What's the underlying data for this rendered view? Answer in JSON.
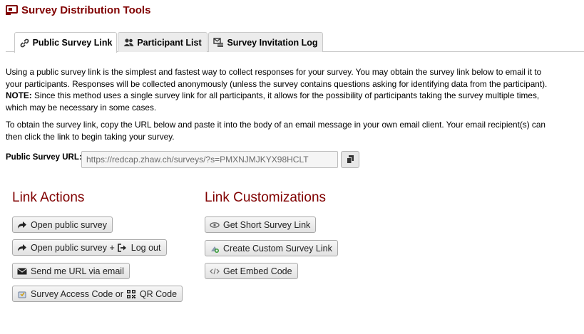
{
  "page": {
    "title": "Survey Distribution Tools",
    "title_icon": "survey-distribution-icon",
    "accent_color": "#800000"
  },
  "tabs": [
    {
      "label": "Public Survey Link",
      "icon": "link-icon",
      "active": true
    },
    {
      "label": "Participant List",
      "icon": "users-icon",
      "active": false
    },
    {
      "label": "Survey Invitation Log",
      "icon": "mail-list-icon",
      "active": false
    }
  ],
  "intro": {
    "text": "Using a public survey link is the simplest and fastest way to collect responses for your survey. You may obtain the survey link below to email it to your participants. Responses will be collected anonymously (unless the survey contains questions asking for identifying data from the participant).",
    "note_label": "NOTE:",
    "note_text": "Since this method uses a single survey link for all participants, it allows for the possibility of participants taking the survey multiple times, which may be necessary in some cases."
  },
  "instructions": "To obtain the survey link, copy the URL below and paste it into the body of an email message in your own email client. Your email recipient(s) can then click the link to begin taking your survey.",
  "url": {
    "label": "Public Survey URL:",
    "value": "https://redcap.zhaw.ch/surveys/?s=PMXNJMJKYX98HCLT",
    "copy_icon": "copy-icon"
  },
  "link_actions": {
    "heading": "Link Actions",
    "buttons": [
      {
        "label": "Open public survey",
        "icon": "share-arrow-icon"
      },
      {
        "label": "Open public survey +",
        "icon": "share-arrow-icon",
        "label2": "Log out",
        "icon2": "logout-icon"
      },
      {
        "label": "Send me URL via email",
        "icon": "envelope-icon"
      },
      {
        "label": "Survey Access Code or",
        "icon": "access-code-icon",
        "label2": "QR Code",
        "icon2": "qr-code-icon"
      }
    ]
  },
  "link_customizations": {
    "heading": "Link Customizations",
    "buttons": [
      {
        "label": "Get Short Survey Link",
        "icon": "short-link-icon"
      },
      {
        "label": "Create Custom Survey Link",
        "icon": "custom-link-icon"
      },
      {
        "label": "Get Embed Code",
        "icon": "embed-code-icon"
      }
    ]
  }
}
